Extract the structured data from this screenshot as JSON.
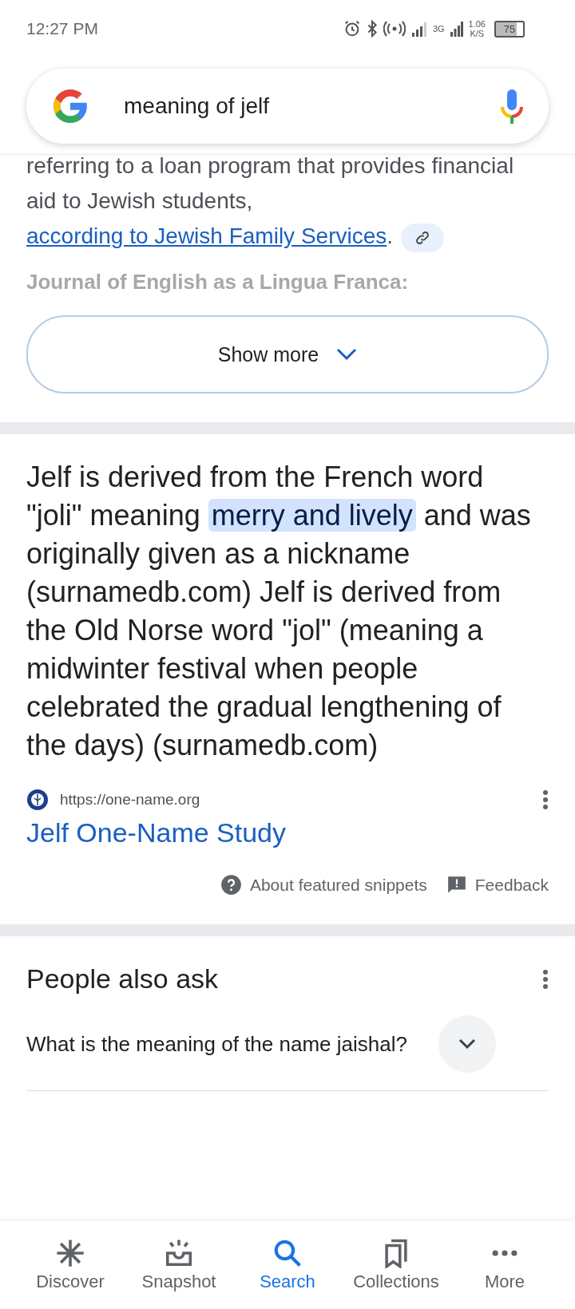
{
  "status_bar": {
    "time": "12:27 PM",
    "network": "3G",
    "speed": "1.06",
    "speed_unit": "K/S",
    "battery": "75"
  },
  "search": {
    "query": "meaning of jelf"
  },
  "previous_snippet": {
    "text": "referring to a loan program that provides financial aid to Jewish students, ",
    "link": "according to Jewish Family Services",
    "after": ".",
    "faded_heading": "Journal of English as a Lingua Franca:"
  },
  "show_more": {
    "label": "Show more"
  },
  "featured_snippet": {
    "before": "Jelf is derived from the French word \"joli\" meaning ",
    "highlight": "merry and lively",
    "after": " and was originally given as a nickname (surnamedb.com) Jelf is derived from the Old Norse word \"jol\" (meaning a midwinter festival when people celebrated the gradual lengthening of the days) (surnamedb.com)",
    "source_url": "https://one-name.org",
    "title": "Jelf One-Name Study",
    "about": "About featured snippets",
    "feedback": "Feedback"
  },
  "people_also_ask": {
    "title": "People also ask",
    "questions": [
      {
        "text": "What is the meaning of the name jaishal?",
        "expanded": false
      }
    ]
  },
  "nav": [
    {
      "label": "Discover",
      "kind": "discover",
      "selected": false
    },
    {
      "label": "Snapshot",
      "kind": "snapshot",
      "selected": false
    },
    {
      "label": "Search",
      "kind": "search",
      "selected": true
    },
    {
      "label": "Collections",
      "kind": "collections",
      "selected": false
    },
    {
      "label": "More",
      "kind": "more",
      "selected": false
    }
  ]
}
